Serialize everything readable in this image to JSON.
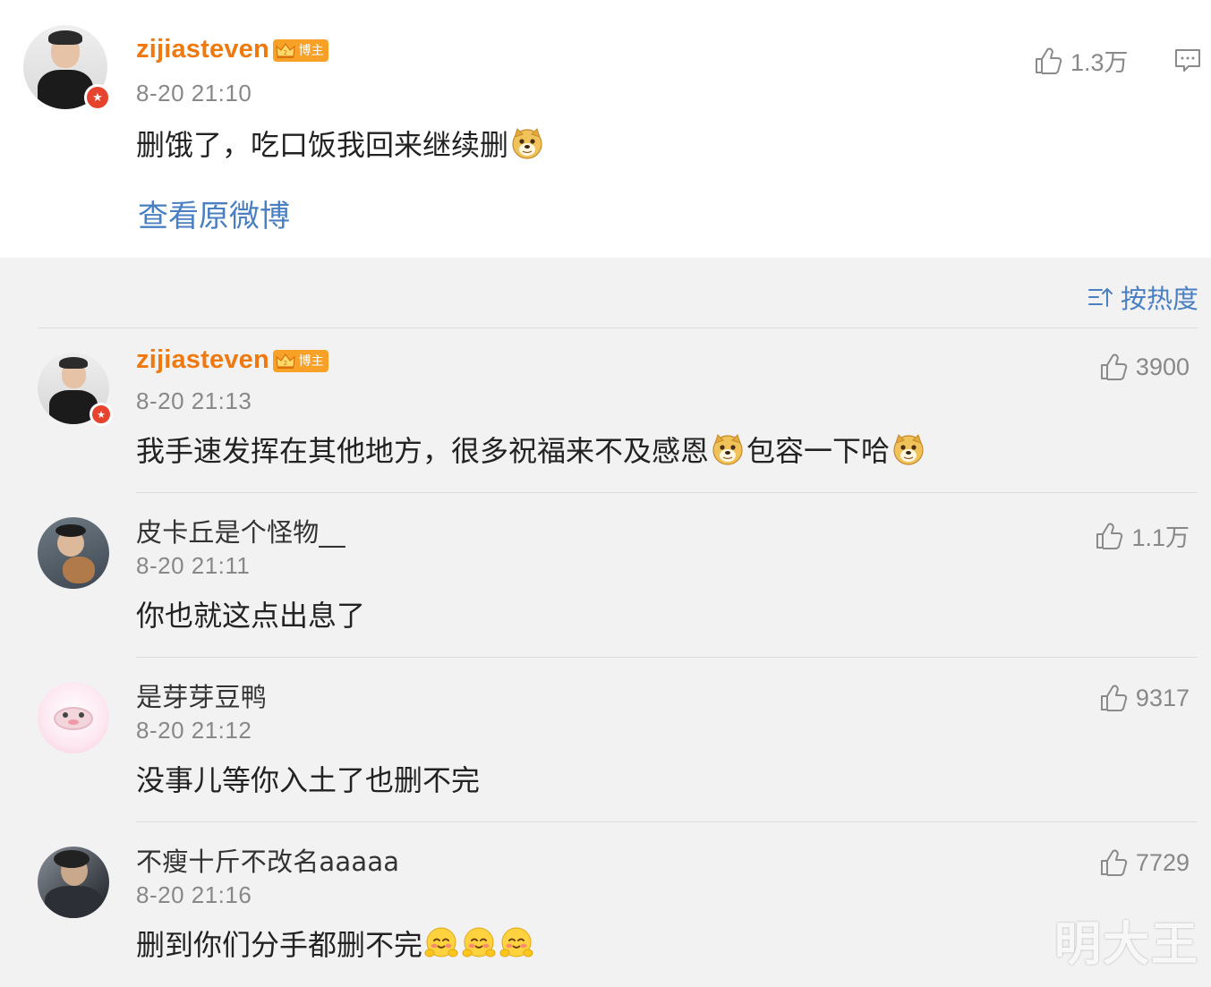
{
  "original": {
    "username": "zijiasteven",
    "badge": "博主",
    "time": "8-20 21:10",
    "text": "删饿了，吃口饭我回来继续删",
    "likes": "1.3万",
    "view_link": "查看原微博"
  },
  "sort": {
    "label": "按热度"
  },
  "comments": [
    {
      "username": "zijiasteven",
      "badge": "博主",
      "time": "8-20 21:13",
      "text_a": "我手速发挥在其他地方，很多祝福来不及感恩",
      "text_b": "包容一下哈",
      "likes": "3900"
    },
    {
      "username": "皮卡丘是个怪物__",
      "time": "8-20 21:11",
      "text": "你也就这点出息了",
      "likes": "1.1万"
    },
    {
      "username": "是芽芽豆鸭",
      "time": "8-20 21:12",
      "text": "没事儿等你入土了也删不完",
      "likes": "9317"
    },
    {
      "username": "不瘦十斤不改名aaaaa",
      "time": "8-20 21:16",
      "text": "删到你们分手都删不完",
      "likes": "7729"
    }
  ],
  "watermark": "明大王",
  "icons": {
    "like": "thumbs-up-icon",
    "comment": "comment-icon",
    "sort": "sort-icon",
    "emoji_doge": "doge-emoji",
    "emoji_hug": "hug-emoji"
  },
  "colors": {
    "username_vip": "#f0790f",
    "link": "#4a7fc1",
    "badge": "#f7a226",
    "verified": "#e6442e"
  }
}
